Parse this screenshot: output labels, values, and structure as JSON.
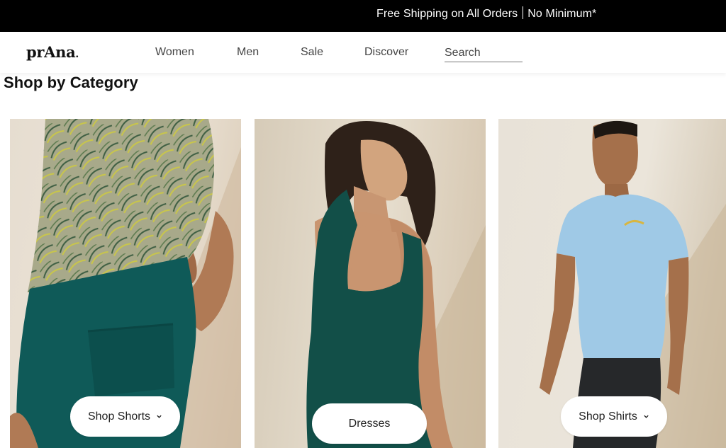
{
  "promo": {
    "text_left": "Free Shipping on All Orders",
    "text_right": "No Minimum*"
  },
  "header": {
    "logo": "prAna",
    "nav": [
      "Women",
      "Men",
      "Sale",
      "Discover"
    ],
    "search_placeholder": "Search"
  },
  "section": {
    "title": "Shop by Category"
  },
  "cards": [
    {
      "image": "model-in-green-cargo-shorts-and-palm-print-shirt",
      "cta": "Shop Shorts",
      "has_dropdown": true
    },
    {
      "image": "model-in-green-racerback-dress",
      "cta": "Dresses",
      "has_dropdown": false
    },
    {
      "image": "model-in-light-blue-t-shirt",
      "cta": "Shop Shirts",
      "has_dropdown": true
    }
  ],
  "colors": {
    "promo_bg": "#000000",
    "shorts_teal": "#0f5a58",
    "dress_green": "#124f48",
    "shirt_blue": "#9fc9e6"
  }
}
